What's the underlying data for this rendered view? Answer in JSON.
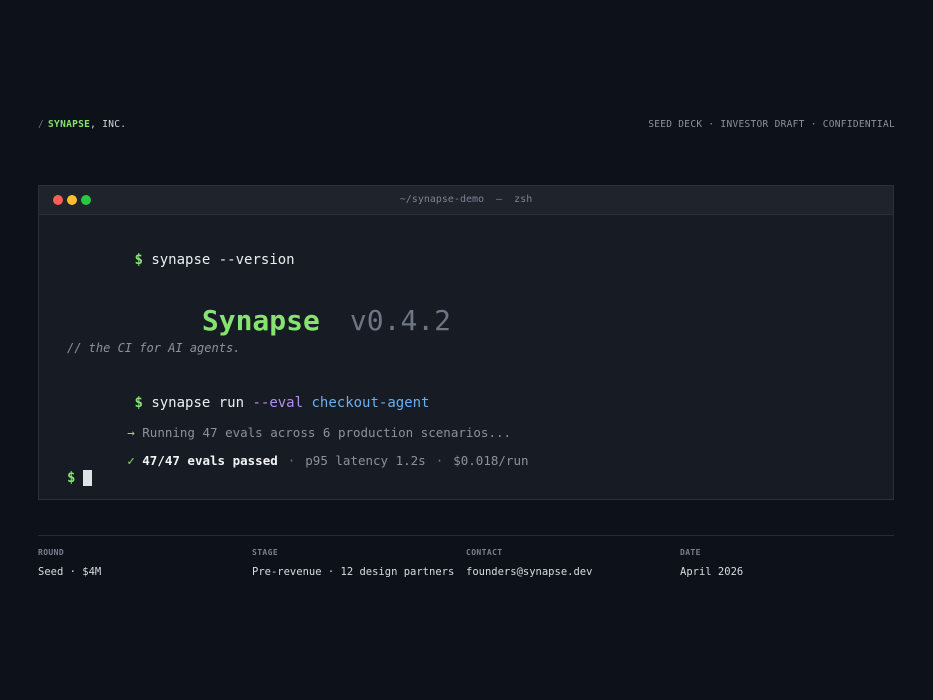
{
  "header": {
    "slash": "/",
    "company_name": "SYNAPSE",
    "company_suffix": ", INC.",
    "tagline": "SEED DECK · INVESTOR DRAFT · CONFIDENTIAL"
  },
  "terminal": {
    "title": "~/synapse-demo  —  zsh",
    "prompt": "$",
    "line1_command": "synapse --version",
    "product_name": "Synapse",
    "product_version": "v0.4.2",
    "comment": "// the CI for AI agents.",
    "line4_command": "synapse run",
    "line4_flag": "--eval",
    "line4_arg": "checkout-agent",
    "running_arrow": "→",
    "running_text": "Running 47 evals across 6 production scenarios...",
    "result_check": "✓",
    "result_passed": "47/47 evals passed",
    "result_sep": "·",
    "result_latency": "p95 latency 1.2s",
    "result_cost": "$0.018/run"
  },
  "footer": {
    "round": {
      "label": "ROUND",
      "value": "Seed · $4M"
    },
    "stage": {
      "label": "STAGE",
      "value": "Pre-revenue · 12 design partners"
    },
    "contact": {
      "label": "CONTACT",
      "value": "founders@synapse.dev"
    },
    "date": {
      "label": "DATE",
      "value": "April 2026"
    }
  },
  "colors": {
    "background": "#0d111a",
    "accent_green": "#86e36f",
    "flag_purple": "#b58ee8",
    "arg_blue": "#6aaef0",
    "window_red": "#ff5f56",
    "window_yellow": "#ffbd2e",
    "window_green": "#27c93f"
  }
}
